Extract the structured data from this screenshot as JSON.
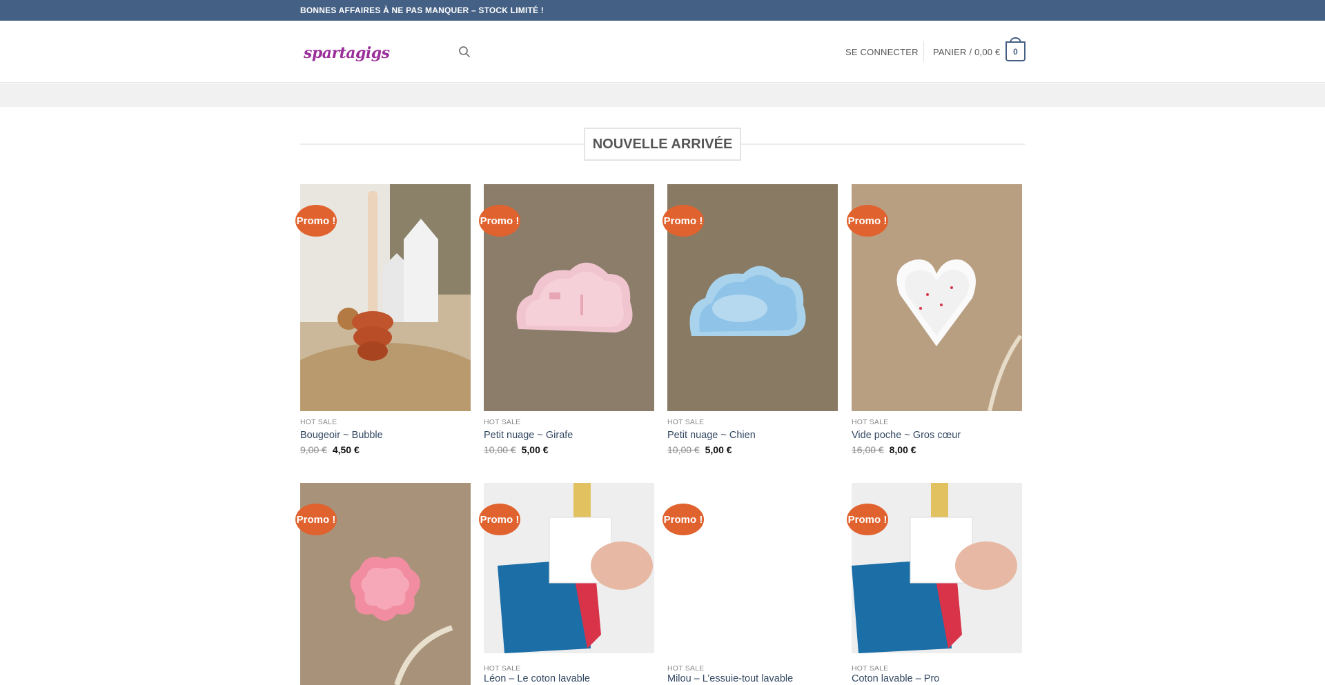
{
  "topbar": {
    "announcement": "BONNES AFFAIRES À NE PAS MANQUER – STOCK LIMITÉ !"
  },
  "header": {
    "logo_text": "spartagigs",
    "login_label": "SE CONNECTER",
    "cart_label": "PANIER / 0,00 €",
    "cart_count": "0"
  },
  "section": {
    "title": "NOUVELLE ARRIVÉE"
  },
  "products": [
    {
      "badge": "Promo !",
      "category": "HOT SALE",
      "name": "Bougeoir ~ Bubble",
      "old_price": "9,00 €",
      "new_price": "4,50 €"
    },
    {
      "badge": "Promo !",
      "category": "HOT SALE",
      "name": "Petit nuage ~ Girafe",
      "old_price": "10,00 €",
      "new_price": "5,00 €"
    },
    {
      "badge": "Promo !",
      "category": "HOT SALE",
      "name": "Petit nuage ~ Chien",
      "old_price": "10,00 €",
      "new_price": "5,00 €"
    },
    {
      "badge": "Promo !",
      "category": "HOT SALE",
      "name": "Vide poche ~ Gros cœur",
      "old_price": "16,00 €",
      "new_price": "8,00 €"
    },
    {
      "badge": "Promo !",
      "category": "",
      "name": "",
      "old_price": "",
      "new_price": ""
    },
    {
      "badge": "Promo !",
      "category": "HOT SALE",
      "name": "Léon – Le coton lavable",
      "old_price": "",
      "new_price": ""
    },
    {
      "badge": "Promo !",
      "category": "HOT SALE",
      "name": "Milou – L’essuie-tout lavable",
      "old_price": "",
      "new_price": ""
    },
    {
      "badge": "Promo !",
      "category": "HOT SALE",
      "name": "Coton lavable – Pro",
      "old_price": "",
      "new_price": ""
    }
  ],
  "colors": {
    "topbar": "#446084",
    "badge": "#e0632f",
    "link": "#334862"
  }
}
